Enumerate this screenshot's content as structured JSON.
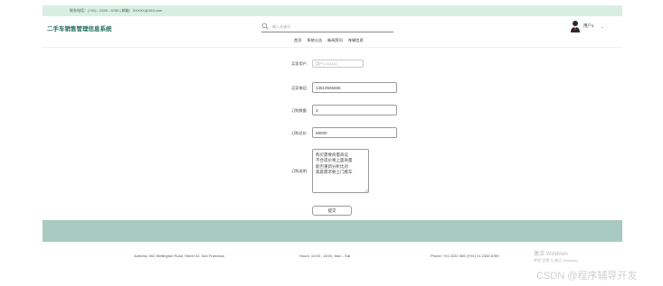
{
  "topbar": {
    "contact_text": "联系电话：(+01) - 2345 - 6789 | 邮箱：XXXXX@163.com"
  },
  "header": {
    "site_title": "二手车销售管理信息系统",
    "search_placeholder": "输入关键词",
    "user_name": "用户1",
    "user_caret": "⌄"
  },
  "nav": {
    "items": [
      "首页",
      "系统公告",
      "新闻资讯",
      "车辆信息"
    ]
  },
  "form": {
    "buyer_account_label": "买家用户:",
    "buyer_account_value": "用户1-111111",
    "buyer_phone_label": "买家电话:",
    "buyer_phone_value": "13513555555",
    "order_quantity_label": "订购数量:",
    "order_quantity_value": "3",
    "order_total_label": "订购总价:",
    "order_total_value": "89000",
    "order_remark_label": "订购说明:",
    "order_remark_value": "购买需要商量商议\n不合适价格上面商量\n能否重新分析比对\n家庭需求要上门看车",
    "submit_label": "提交"
  },
  "footer": {
    "address": "Address: 562 Wellington Road, Street 32, San Francisco",
    "hours": "Hours: 10:00 - 18:00, Mon - Sat",
    "phone": "Phone: +01 2222 365 /(+91) 01 2345 6789"
  },
  "overlay": {
    "windows_title": "激活 Windows",
    "windows_sub": "转到\"设置\"以激活 Windows。",
    "csdn_watermark": "CSDN @程序辅导开发"
  },
  "colors": {
    "topbar_bg": "#d8eee2",
    "title_green": "#1f6b5a",
    "footer_band": "#a8cac1"
  }
}
